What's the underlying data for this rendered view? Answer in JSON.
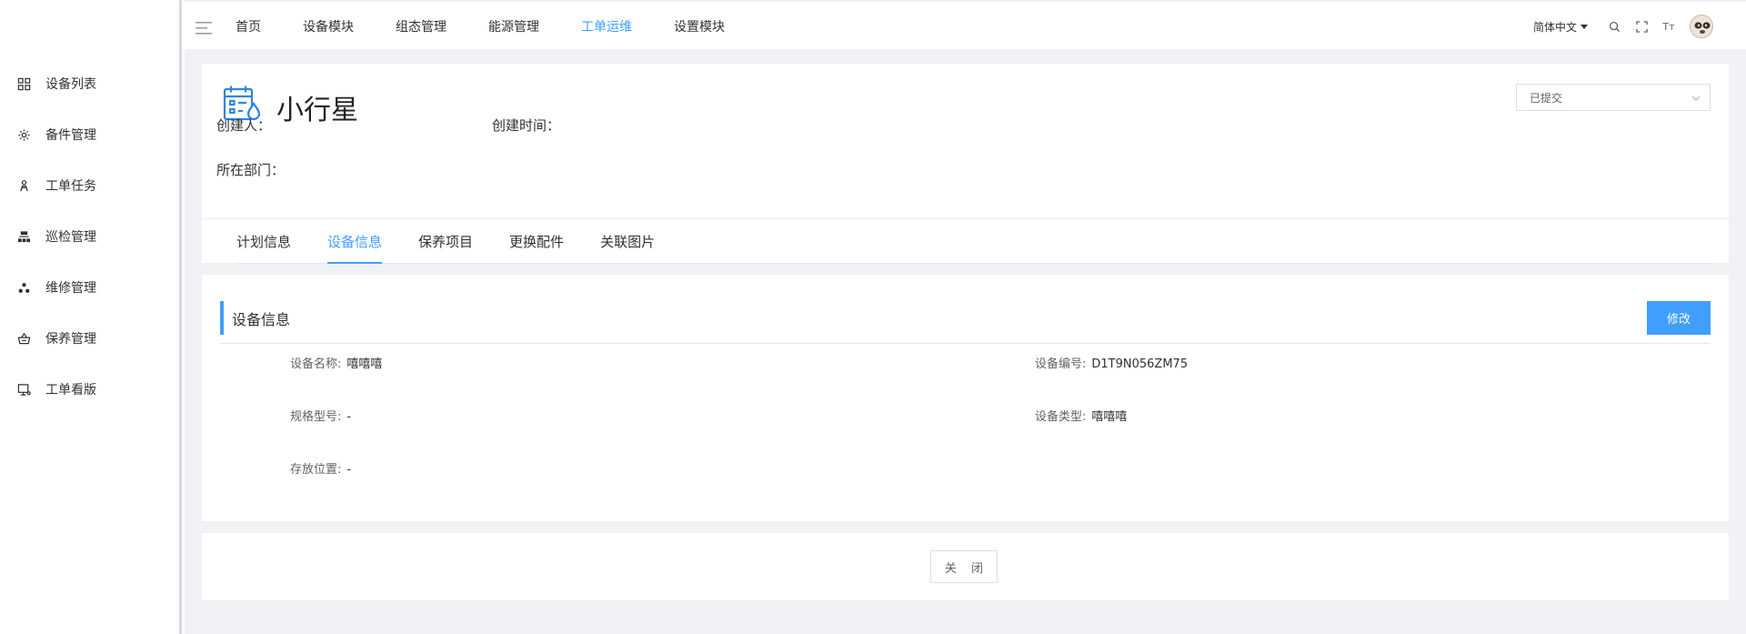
{
  "sidebar": {
    "items": [
      {
        "label": "设备列表",
        "icon": "grid-icon"
      },
      {
        "label": "备件管理",
        "icon": "gear-icon"
      },
      {
        "label": "工单任务",
        "icon": "person-icon"
      },
      {
        "label": "巡检管理",
        "icon": "sitemap-icon"
      },
      {
        "label": "维修管理",
        "icon": "cluster-icon"
      },
      {
        "label": "保养管理",
        "icon": "basket-icon"
      },
      {
        "label": "工单看版",
        "icon": "monitor-icon"
      }
    ]
  },
  "topbar": {
    "nav": [
      "首页",
      "设备模块",
      "组态管理",
      "能源管理",
      "工单运维",
      "设置模块"
    ],
    "active_nav": "工单运维",
    "language": "简体中文",
    "icons": [
      "search-icon",
      "fullscreen-icon",
      "font-size-icon",
      "avatar"
    ],
    "font_icon_text": "Tт"
  },
  "header": {
    "title": "小行星",
    "status": "已提交",
    "creator_label": "创建人：",
    "creator_value": "",
    "created_time_label": "创建时间：",
    "created_time_value": "",
    "dept_label": "所在部门：",
    "dept_value": ""
  },
  "tabs": {
    "items": [
      "计划信息",
      "设备信息",
      "保养项目",
      "更换配件",
      "关联图片"
    ],
    "active": "设备信息"
  },
  "device_info": {
    "section_title": "设备信息",
    "edit_label": "修改",
    "name_label": "设备名称:",
    "name_value": "嘻嘻嘻",
    "code_label": "设备编号:",
    "code_value": "D1T9N056ZM75",
    "model_label": "规格型号:",
    "model_value": "-",
    "type_label": "设备类型:",
    "type_value": "嘻嘻嘻",
    "location_label": "存放位置:",
    "location_value": "-"
  },
  "footer": {
    "close_label": "关 闭"
  },
  "colors": {
    "accent": "#409eff",
    "background": "#f0f2f5"
  }
}
